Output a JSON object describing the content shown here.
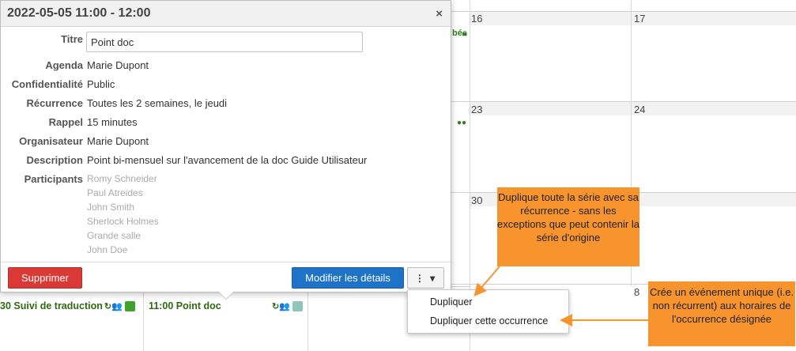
{
  "popup": {
    "title": "2022-05-05 11:00 - 12:00",
    "close_icon": "×",
    "fields": {
      "titre_label": "Titre",
      "titre_value": "Point doc",
      "agenda_label": "Agenda",
      "agenda_value": "Marie Dupont",
      "confidentialite_label": "Confidentialité",
      "confidentialite_value": "Public",
      "recurrence_label": "Récurrence",
      "recurrence_value": "Toutes les 2 semaines, le jeudi",
      "rappel_label": "Rappel",
      "rappel_value": "15 minutes",
      "organisateur_label": "Organisateur",
      "organisateur_value": "Marie Dupont",
      "description_label": "Description",
      "description_value": "Point bi-mensuel sur l'avancement de la doc Guide Utilisateur",
      "participants_label": "Participants"
    },
    "participants": [
      "Romy Schneider",
      "Paul Atreides",
      "John Smith",
      "Sherlock Holmes",
      "Grande salle",
      "John Doe"
    ],
    "buttons": {
      "delete": "Supprimer",
      "edit": "Modifier les détails",
      "more": "⋮ ▾"
    }
  },
  "menu": {
    "items": [
      "Dupliquer",
      "Dupliquer cette occurrence"
    ]
  },
  "callouts": {
    "c1": "Duplique toute la série avec sa récurrence - sans les exceptions que peut contenir la série d'origine",
    "c2": "Crée un événement unique (i.e. non récurrent) aux horaires de l'occurrence désignée"
  },
  "calendar": {
    "day_numbers": [
      "16",
      "17",
      "23",
      "24",
      "30",
      "8"
    ],
    "events": [
      {
        "label": "30 Suivi de traduction",
        "icons": "↻👥",
        "color": "#3fa32a"
      },
      {
        "label": "11:00 Point doc",
        "icons": "↻👥",
        "color": "#8fc6b9"
      }
    ],
    "peek_text": "bé"
  },
  "colors": {
    "accent_orange": "#f7942e",
    "delete_red": "#d93a35",
    "edit_blue": "#1e73c8",
    "event_green": "#2e6b12"
  }
}
